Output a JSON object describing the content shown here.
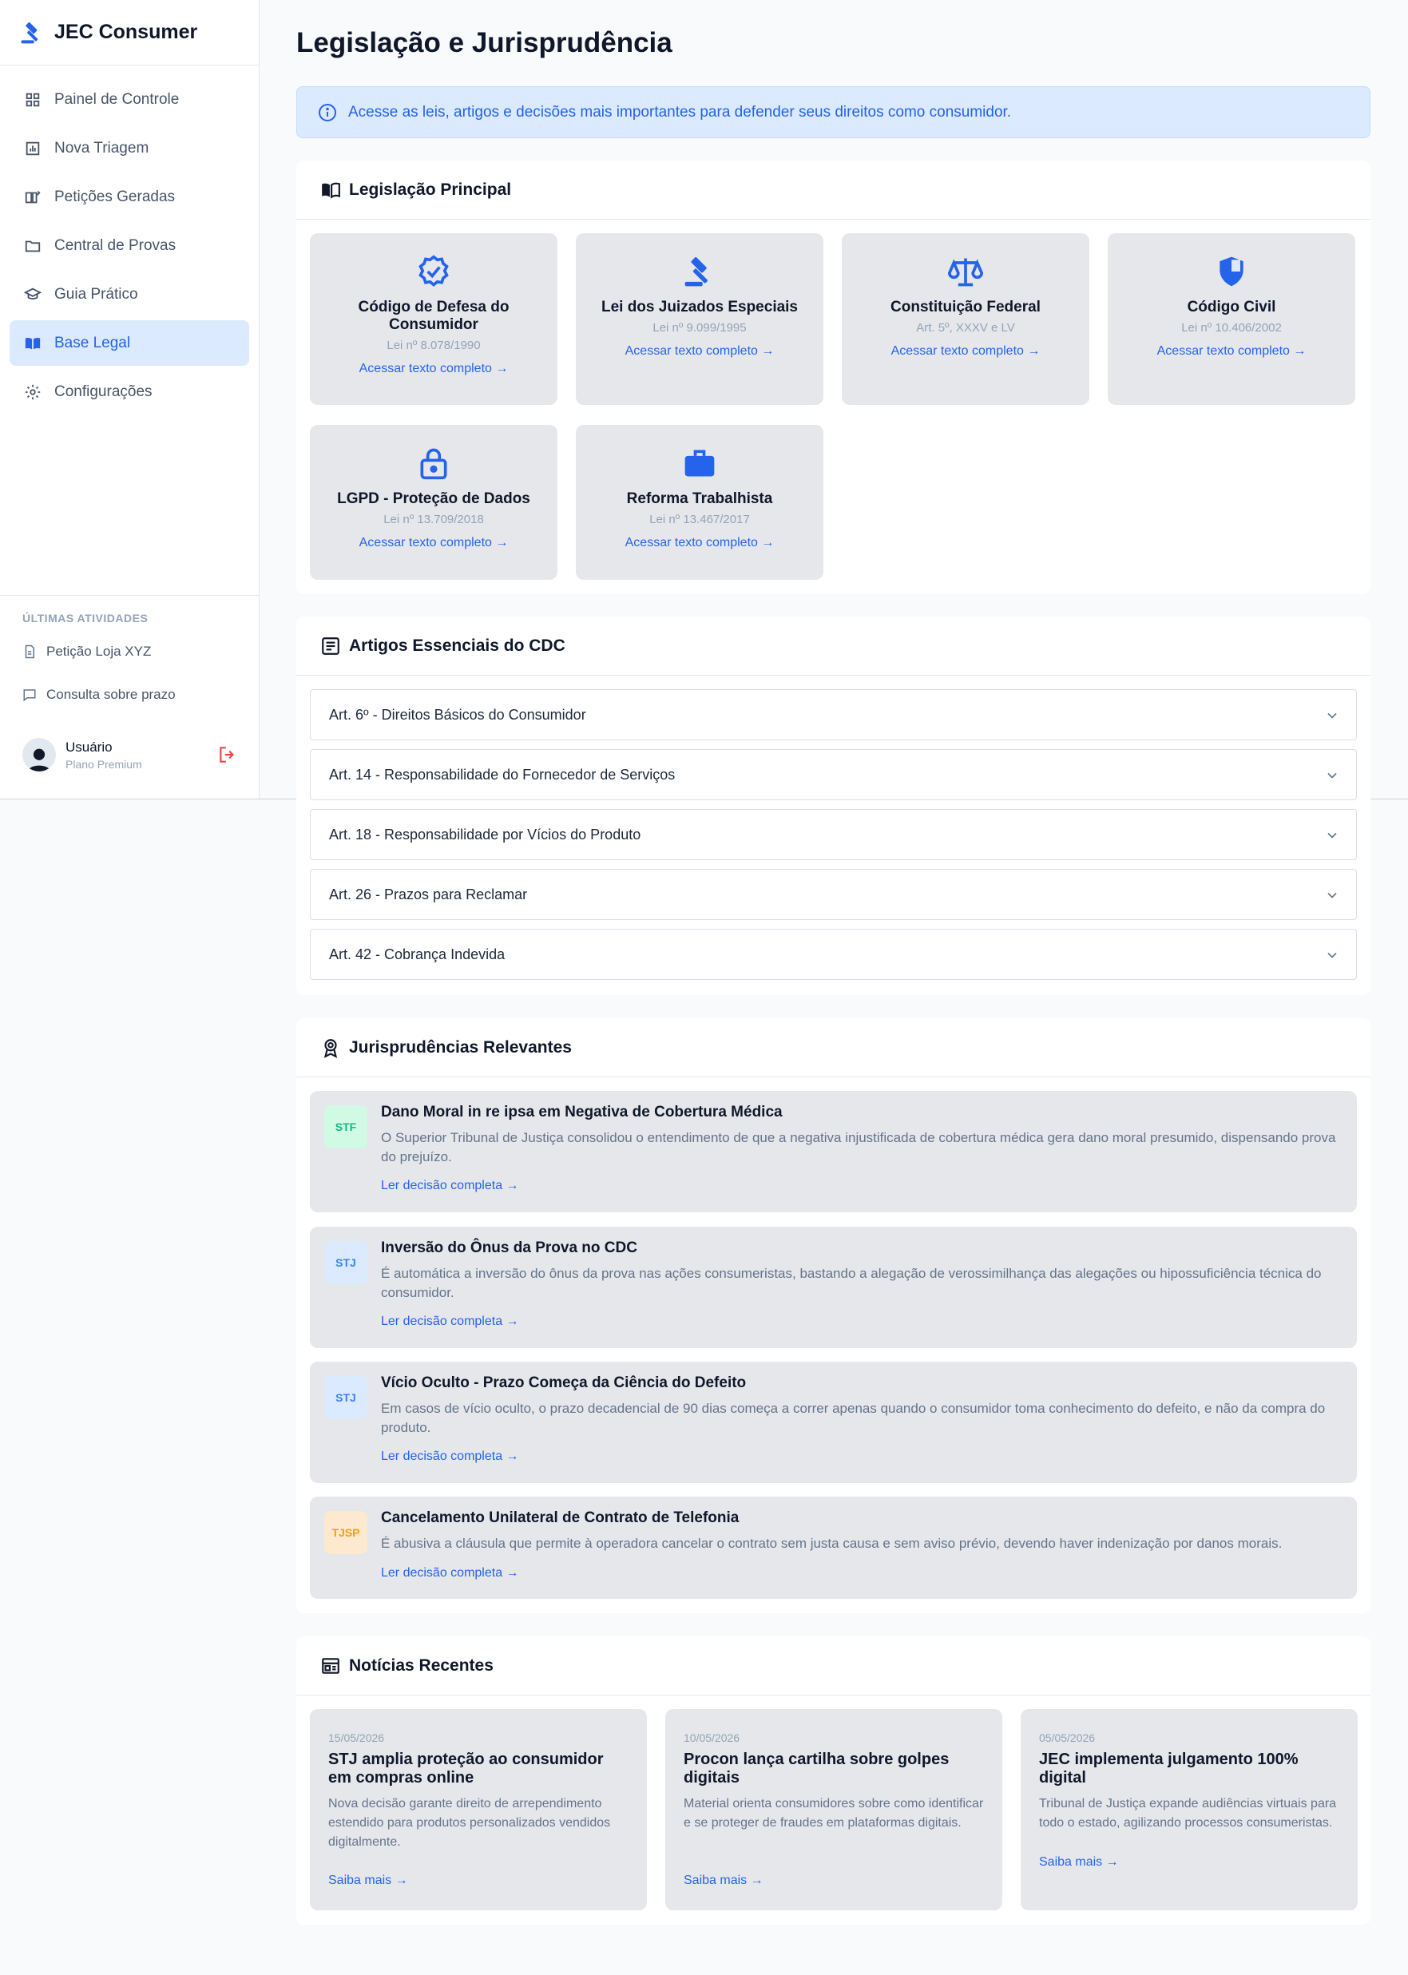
{
  "app": {
    "name": "JEC Consumer"
  },
  "sidebar": {
    "items": [
      {
        "label": "Painel de Controle",
        "icon": "dashboard-icon"
      },
      {
        "label": "Nova Triagem",
        "icon": "chart-icon"
      },
      {
        "label": "Petições Geradas",
        "icon": "book-edit-icon"
      },
      {
        "label": "Central de Provas",
        "icon": "folder-icon"
      },
      {
        "label": "Guia Prático",
        "icon": "graduation-cap-icon"
      },
      {
        "label": "Base Legal",
        "icon": "book-icon",
        "active": true
      },
      {
        "label": "Configurações",
        "icon": "gear-icon"
      }
    ],
    "activities_heading": "ÚLTIMAS ATIVIDADES",
    "activities": [
      {
        "label": "Petição Loja XYZ",
        "icon": "document-icon"
      },
      {
        "label": "Consulta sobre prazo",
        "icon": "chat-icon"
      }
    ],
    "user": {
      "name": "Usuário",
      "plan": "Plano Premium"
    }
  },
  "main": {
    "title": "Legislação e Jurisprudência",
    "info": "Acesse as leis, artigos e decisões mais importantes para defender seus direitos como consumidor.",
    "legislation": {
      "heading": "Legislação Principal",
      "link_label": "Acessar texto completo →",
      "items": [
        {
          "title": "Código de Defesa do Consumidor",
          "sub": "Lei nº 8.078/1990",
          "icon": "verified-badge-icon"
        },
        {
          "title": "Lei dos Juizados Especiais",
          "sub": "Lei nº 9.099/1995",
          "icon": "gavel-icon"
        },
        {
          "title": "Constituição Federal",
          "sub": "Art. 5º, XXXV e LV",
          "icon": "scales-icon"
        },
        {
          "title": "Código Civil",
          "sub": "Lei nº 10.406/2002",
          "icon": "shield-icon"
        },
        {
          "title": "LGPD - Proteção de Dados",
          "sub": "Lei nº 13.709/2018",
          "icon": "lock-icon"
        },
        {
          "title": "Reforma Trabalhista",
          "sub": "Lei nº 13.467/2017",
          "icon": "briefcase-icon"
        }
      ]
    },
    "articles": {
      "heading": "Artigos Essenciais do CDC",
      "items": [
        "Art. 6º - Direitos Básicos do Consumidor",
        "Art. 14 - Responsabilidade do Fornecedor de Serviços",
        "Art. 18 - Responsabilidade por Vícios do Produto",
        "Art. 26 - Prazos para Reclamar",
        "Art. 42 - Cobrança Indevida"
      ]
    },
    "jurisprudence": {
      "heading": "Jurisprudências Relevantes",
      "link_label": "Ler decisão completa →",
      "items": [
        {
          "court": "STF",
          "title": "Dano Moral in re ipsa em Negativa de Cobertura Médica",
          "text": "O Superior Tribunal de Justiça consolidou o entendimento de que a negativa injustificada de cobertura médica gera dano moral presumido, dispensando prova do prejuízo.",
          "badge_bg": "#d1fae5",
          "badge_fg": "#10b981"
        },
        {
          "court": "STJ",
          "title": "Inversão do Ônus da Prova no CDC",
          "text": "É automática a inversão do ônus da prova nas ações consumeristas, bastando a alegação de verossimilhança das alegações ou hipossuficiência técnica do consumidor.",
          "badge_bg": "#dbeafe",
          "badge_fg": "#3b82f6"
        },
        {
          "court": "STJ",
          "title": "Vício Oculto - Prazo Começa da Ciência do Defeito",
          "text": "Em casos de vício oculto, o prazo decadencial de 90 dias começa a correr apenas quando o consumidor toma conhecimento do defeito, e não da compra do produto.",
          "badge_bg": "#dbeafe",
          "badge_fg": "#3b82f6"
        },
        {
          "court": "TJSP",
          "title": "Cancelamento Unilateral de Contrato de Telefonia",
          "text": "É abusiva a cláusula que permite à operadora cancelar o contrato sem justa causa e sem aviso prévio, devendo haver indenização por danos morais.",
          "badge_bg": "#fde9cf",
          "badge_fg": "#f59e0b"
        }
      ]
    },
    "news": {
      "heading": "Notícias Recentes",
      "link_label": "Saiba mais →",
      "items": [
        {
          "date": "15/05/2026",
          "title": "STJ amplia proteção ao consumidor em compras online",
          "text": "Nova decisão garante direito de arrependimento estendido para produtos personalizados vendidos digitalmente."
        },
        {
          "date": "10/05/2026",
          "title": "Procon lança cartilha sobre golpes digitais",
          "text": "Material orienta consumidores sobre como identificar e se proteger de fraudes em plataformas digitais."
        },
        {
          "date": "05/05/2026",
          "title": "JEC implementa julgamento 100% digital",
          "text": "Tribunal de Justiça expande audiências virtuais para todo o estado, agilizando processos consumeristas."
        }
      ]
    }
  },
  "colors": {
    "accent": "#2563eb",
    "accent_light": "#dbeafe",
    "card_bg": "#e5e7eb",
    "danger": "#ef4444"
  }
}
